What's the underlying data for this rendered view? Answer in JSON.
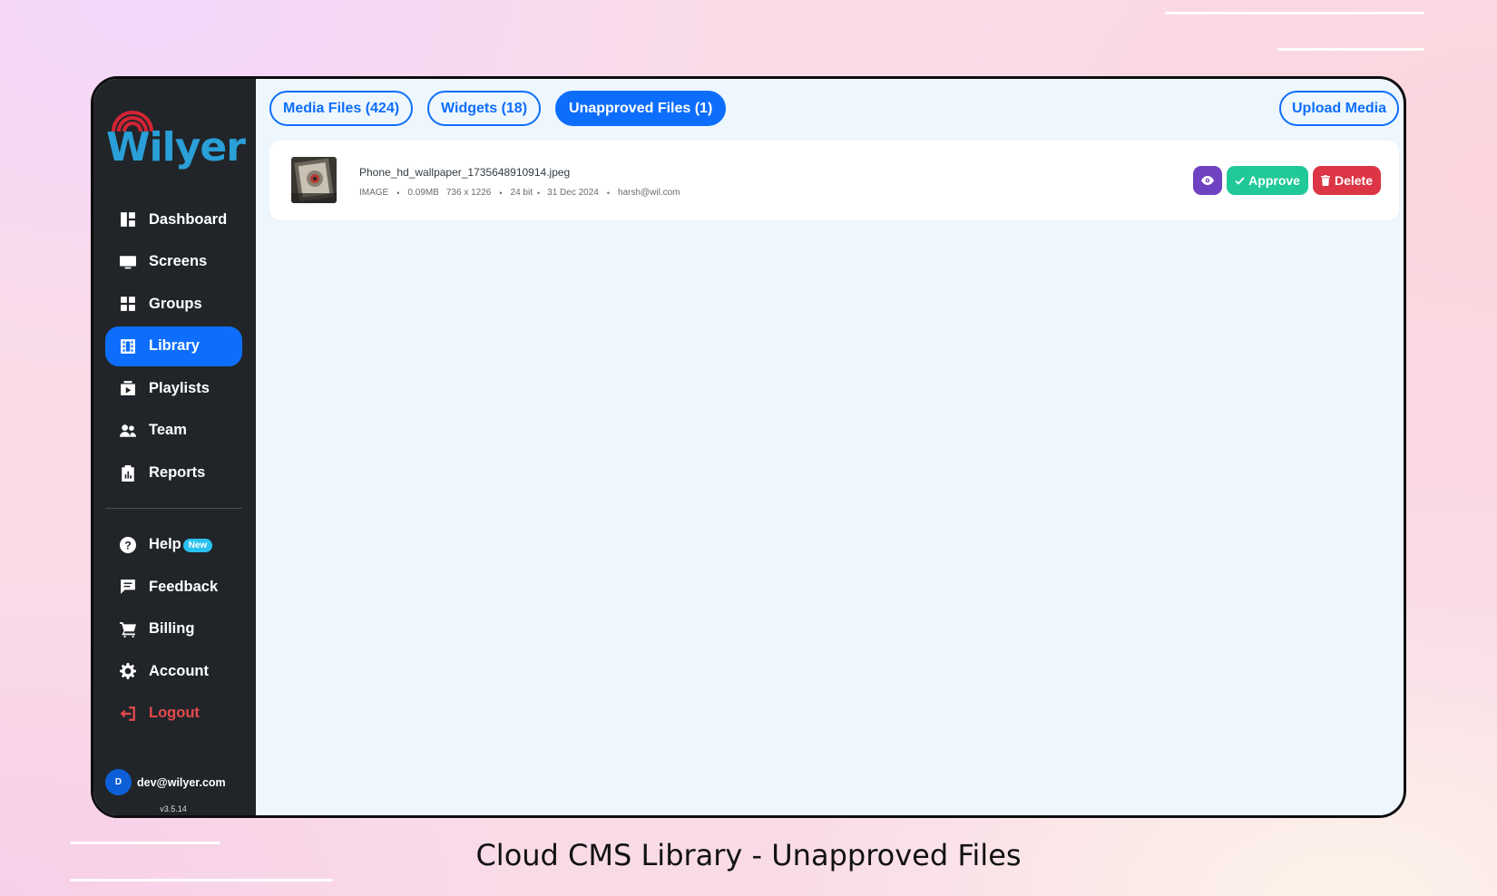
{
  "brand": {
    "name": "Wilyer",
    "color": "#2a9fd8",
    "accent": "#d32434"
  },
  "sidebar": {
    "items": [
      {
        "label": "Dashboard",
        "icon": "dashboard-icon"
      },
      {
        "label": "Screens",
        "icon": "monitor-icon"
      },
      {
        "label": "Groups",
        "icon": "grid-icon"
      },
      {
        "label": "Library",
        "icon": "film-icon",
        "active": true
      },
      {
        "label": "Playlists",
        "icon": "playlist-icon"
      },
      {
        "label": "Team",
        "icon": "team-icon"
      },
      {
        "label": "Reports",
        "icon": "clipboard-icon"
      }
    ],
    "secondary": [
      {
        "label": "Help",
        "icon": "help-icon",
        "badge": "New"
      },
      {
        "label": "Feedback",
        "icon": "feedback-icon"
      },
      {
        "label": "Billing",
        "icon": "cart-icon"
      },
      {
        "label": "Account",
        "icon": "gear-icon"
      },
      {
        "label": "Logout",
        "icon": "logout-icon"
      }
    ],
    "user": {
      "initial": "D",
      "email": "dev@wilyer.com"
    },
    "version": "v3.5.14"
  },
  "tabs": [
    {
      "label": "Media Files (424)",
      "active": false
    },
    {
      "label": "Widgets (18)",
      "active": false
    },
    {
      "label": "Unapproved Files (1)",
      "active": true
    }
  ],
  "upload_label": "Upload Media",
  "file": {
    "name": "Phone_hd_wallpaper_1735648910914.jpeg",
    "type": "IMAGE",
    "size": "0.09MB",
    "dimensions": "736 x 1226",
    "bit_depth": "24 bit",
    "date": "31 Dec 2024",
    "uploader": "harsh@wil.com"
  },
  "actions": {
    "view_icon": "eye-icon",
    "approve": "Approve",
    "delete": "Delete"
  },
  "caption": "Cloud CMS Library - Unapproved Files",
  "colors": {
    "primary": "#0d6efd",
    "approve": "#20c997",
    "delete": "#dc3545",
    "view": "#6f42c1",
    "sidebar": "#212529"
  }
}
